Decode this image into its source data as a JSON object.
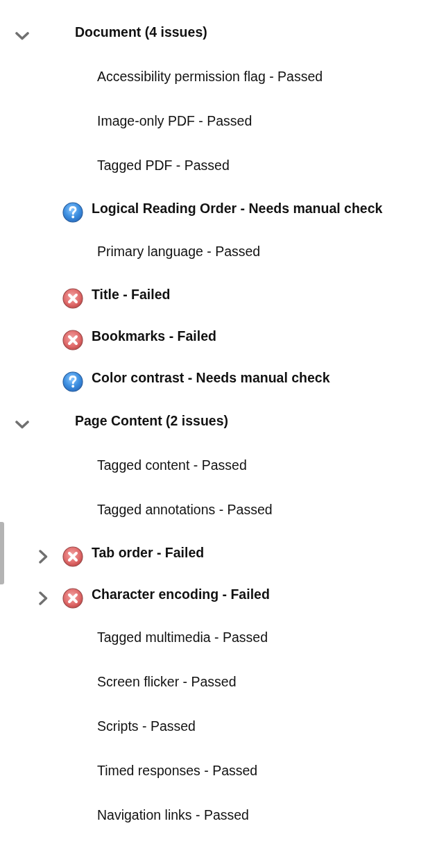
{
  "groups": [
    {
      "title": "Document (4 issues)",
      "expanded": true,
      "items": [
        {
          "label": "Accessibility permission flag - Passed",
          "kind": "passed"
        },
        {
          "label": "Image-only PDF - Passed",
          "kind": "passed"
        },
        {
          "label": "Tagged PDF - Passed",
          "kind": "passed"
        },
        {
          "label": "Logical Reading Order - Needs manual check",
          "kind": "manual"
        },
        {
          "label": "Primary language - Passed",
          "kind": "passed"
        },
        {
          "label": "Title - Failed",
          "kind": "failed"
        },
        {
          "label": "Bookmarks - Failed",
          "kind": "failed"
        },
        {
          "label": "Color contrast - Needs manual check",
          "kind": "manual"
        }
      ]
    },
    {
      "title": "Page Content (2 issues)",
      "expanded": true,
      "items": [
        {
          "label": "Tagged content - Passed",
          "kind": "passed"
        },
        {
          "label": "Tagged annotations - Passed",
          "kind": "passed"
        },
        {
          "label": "Tab order - Failed",
          "kind": "failed",
          "expanded": false
        },
        {
          "label": "Character encoding - Failed",
          "kind": "failed",
          "expanded": false
        },
        {
          "label": "Tagged multimedia - Passed",
          "kind": "passed"
        },
        {
          "label": "Screen flicker - Passed",
          "kind": "passed"
        },
        {
          "label": "Scripts - Passed",
          "kind": "passed"
        },
        {
          "label": "Timed responses - Passed",
          "kind": "passed"
        },
        {
          "label": "Navigation links - Passed",
          "kind": "passed"
        }
      ]
    }
  ]
}
